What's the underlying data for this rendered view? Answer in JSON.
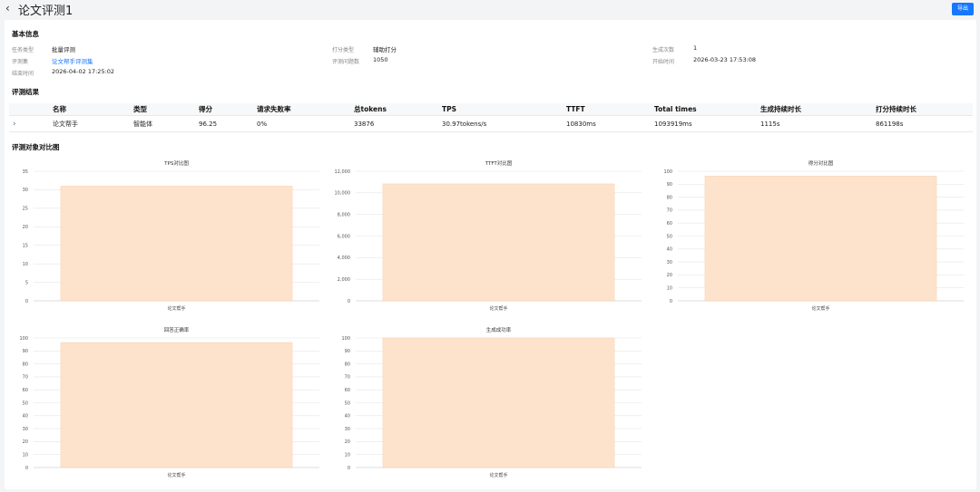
{
  "header": {
    "title": "论文评测1",
    "export_label": "导出"
  },
  "basic": {
    "section_title": "基本信息",
    "fields": [
      {
        "label": "任务类型",
        "value": "批量评测"
      },
      {
        "label": "打分类型",
        "value": "辅助打分"
      },
      {
        "label": "生成次数",
        "value": "1"
      },
      {
        "label": "评测集",
        "value": "论文帮手评测集"
      },
      {
        "label": "评测问题数",
        "value": "1050"
      },
      {
        "label": "开始时间",
        "value": "2026-03-23 17:53:08"
      },
      {
        "label": "结束时间",
        "value": "2026-04-02 17:25:02"
      }
    ]
  },
  "results": {
    "section_title": "评测结果",
    "columns": [
      "名称",
      "类型",
      "得分",
      "请求失败率",
      "总tokens",
      "TPS",
      "TTFT",
      "Total times",
      "生成持续时长",
      "打分持续时长"
    ],
    "rows": [
      [
        "论文帮手",
        "智能体",
        "96.25",
        "0%",
        "33876",
        "30.97tokens/s",
        "10830ms",
        "1093919ms",
        "1115s",
        "861198s"
      ]
    ]
  },
  "compare": {
    "section_title": "评测对象对比图"
  },
  "colors": {
    "bar_fill": "#fde3cc",
    "bar_stroke": "#f9c9a2",
    "grid": "#e6e6e6",
    "accent": "#1677ff"
  },
  "chart_data": [
    {
      "type": "bar",
      "title": "TPS对比图",
      "categories": [
        "论文帮手"
      ],
      "values": [
        30.97
      ],
      "ylim": [
        0,
        35
      ],
      "yticks": [
        "0",
        "5",
        "10",
        "15",
        "20",
        "25",
        "30",
        "35"
      ]
    },
    {
      "type": "bar",
      "title": "TTFT对比图",
      "categories": [
        "论文帮手"
      ],
      "values": [
        10830
      ],
      "ylim": [
        0,
        12000
      ],
      "yticks": [
        "0",
        "2,000",
        "4,000",
        "6,000",
        "8,000",
        "10,000",
        "12,000"
      ]
    },
    {
      "type": "bar",
      "title": "得分对比图",
      "categories": [
        "论文帮手"
      ],
      "values": [
        96.25
      ],
      "ylim": [
        0,
        100
      ],
      "yticks": [
        "0",
        "10",
        "20",
        "30",
        "40",
        "50",
        "60",
        "70",
        "80",
        "90",
        "100"
      ]
    },
    {
      "type": "bar",
      "title": "回答正确率",
      "categories": [
        "论文帮手"
      ],
      "values": [
        96.5
      ],
      "ylim": [
        0,
        100
      ],
      "yticks": [
        "0",
        "10",
        "20",
        "30",
        "40",
        "50",
        "60",
        "70",
        "80",
        "90",
        "100"
      ]
    },
    {
      "type": "bar",
      "title": "生成成功率",
      "categories": [
        "论文帮手"
      ],
      "values": [
        100
      ],
      "ylim": [
        0,
        100
      ],
      "yticks": [
        "0",
        "10",
        "20",
        "30",
        "40",
        "50",
        "60",
        "70",
        "80",
        "90",
        "100"
      ]
    }
  ]
}
